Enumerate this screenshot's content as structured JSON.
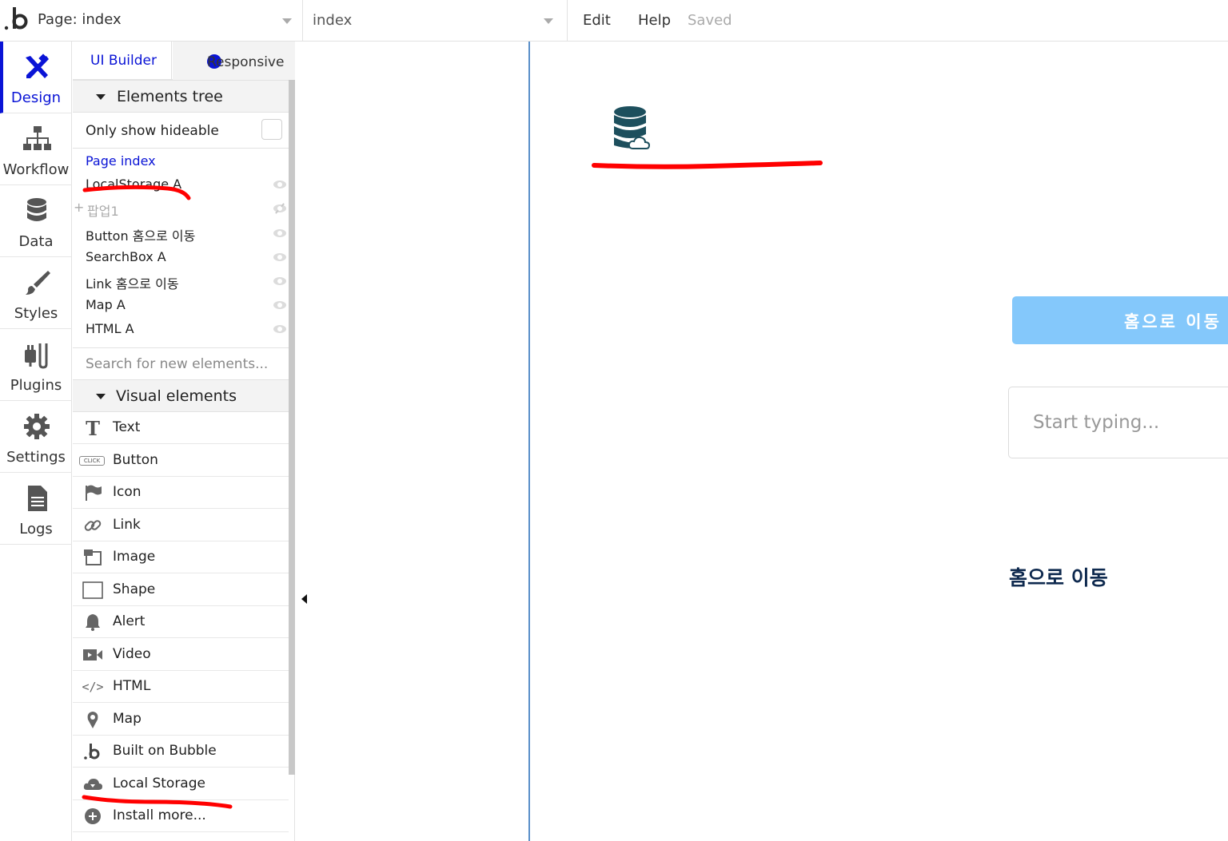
{
  "topbar": {
    "page_label": "Page: index",
    "view_label": "index",
    "menu": {
      "edit": "Edit",
      "help": "Help"
    },
    "status": "Saved"
  },
  "leftnav": {
    "items": [
      {
        "label": "Design",
        "icon": "design-icon"
      },
      {
        "label": "Workflow",
        "icon": "workflow-icon"
      },
      {
        "label": "Data",
        "icon": "database-icon"
      },
      {
        "label": "Styles",
        "icon": "brush-icon"
      },
      {
        "label": "Plugins",
        "icon": "plug-icon"
      },
      {
        "label": "Settings",
        "icon": "gear-icon"
      },
      {
        "label": "Logs",
        "icon": "document-icon"
      }
    ]
  },
  "palette": {
    "tabs": {
      "ui_builder": "UI Builder",
      "responsive": "Responsive"
    },
    "elements_tree": {
      "title": "Elements tree",
      "only_show_hideable": "Only show hideable",
      "items": [
        {
          "label": "Page index"
        },
        {
          "label": "LocalStorage A"
        },
        {
          "label": "팝업1"
        },
        {
          "label": "Button 홈으로 이동"
        },
        {
          "label": "SearchBox A"
        },
        {
          "label": "Link 홈으로 이동"
        },
        {
          "label": "Map A"
        },
        {
          "label": "HTML A"
        }
      ]
    },
    "search_placeholder": "Search for new elements...",
    "visual_elements": {
      "title": "Visual elements",
      "items": [
        {
          "label": "Text",
          "icon": "text-icon"
        },
        {
          "label": "Button",
          "icon": "button-icon",
          "icon_text": "CLICK"
        },
        {
          "label": "Icon",
          "icon": "flag-icon"
        },
        {
          "label": "Link",
          "icon": "link-icon"
        },
        {
          "label": "Image",
          "icon": "image-icon"
        },
        {
          "label": "Shape",
          "icon": "shape-icon"
        },
        {
          "label": "Alert",
          "icon": "bell-icon"
        },
        {
          "label": "Video",
          "icon": "video-icon"
        },
        {
          "label": "HTML",
          "icon": "code-icon"
        },
        {
          "label": "Map",
          "icon": "map-pin-icon"
        },
        {
          "label": "Built on Bubble",
          "icon": "bubble-logo-icon"
        },
        {
          "label": "Local Storage",
          "icon": "cloud-download-icon"
        },
        {
          "label": "Install more...",
          "icon": "plus-circle-icon"
        }
      ]
    }
  },
  "canvas": {
    "button_label": "홈으로 이동",
    "search_placeholder": "Start typing...",
    "link_label": "홈으로 이동"
  },
  "colors": {
    "accent": "#0a14d6",
    "button": "#84c8fb",
    "link": "#0f2a4f",
    "annotation": "#ff0000",
    "database_icon": "#1d4f5d"
  }
}
